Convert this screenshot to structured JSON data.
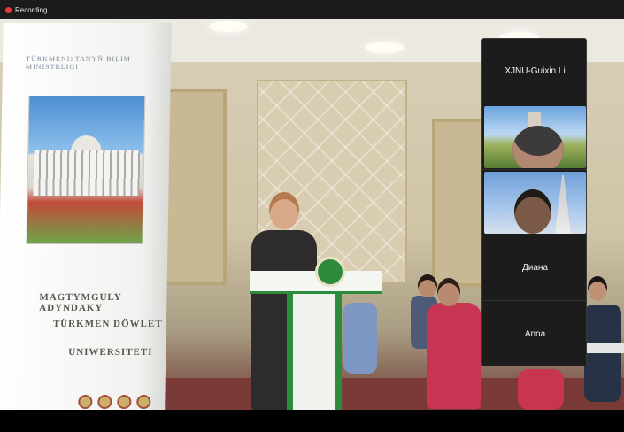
{
  "topbar": {
    "recording_label": "Recording"
  },
  "scene": {
    "banner": {
      "top_text": "TÜRKMENISTANYŇ BILIM MINISTRLIGI",
      "line1": "MAGTYMGULY ADYNDAKY",
      "line2": "TÜRKMEN DÖWLET",
      "line3": "UNIWERSITETI"
    }
  },
  "participants": [
    {
      "name": "XJNU-Guixin Li",
      "video": false
    },
    {
      "name": "",
      "video": true
    },
    {
      "name": "",
      "video": true
    },
    {
      "name": "Диана",
      "video": false
    },
    {
      "name": "Anna",
      "video": false
    }
  ],
  "colors": {
    "recording_dot": "#e53935",
    "tile_bg": "#1c1c1c",
    "podium_green": "#2e8a3c"
  }
}
